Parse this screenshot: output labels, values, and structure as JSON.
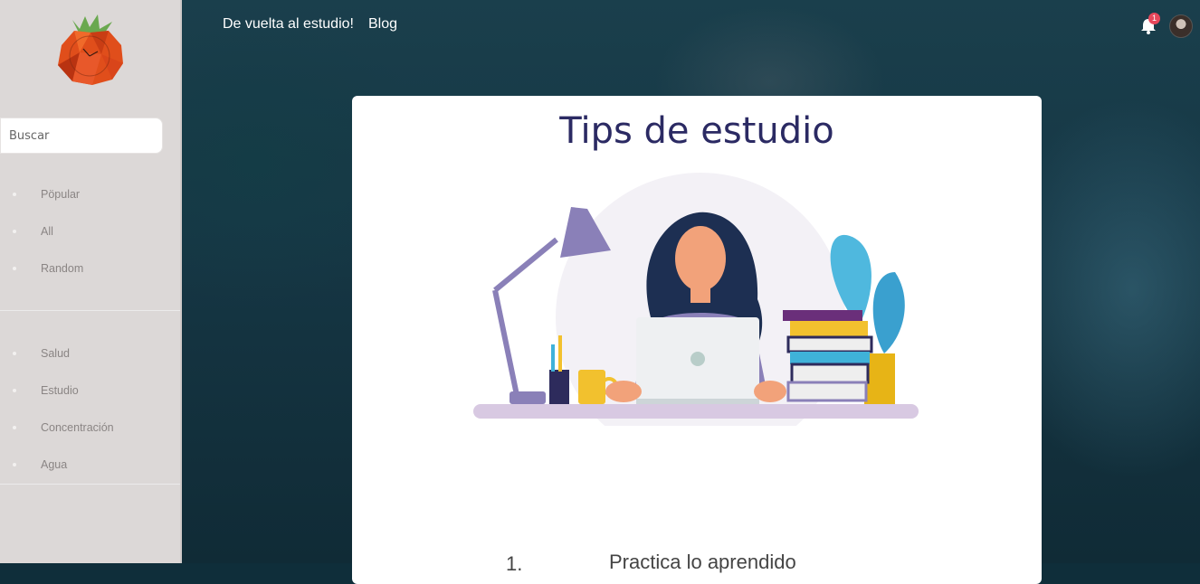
{
  "sidebar": {
    "search_placeholder": "Buscar",
    "primary_items": [
      {
        "label": "Pöpular"
      },
      {
        "label": "All"
      },
      {
        "label": "Random"
      }
    ],
    "category_items": [
      {
        "label": "Salud"
      },
      {
        "label": "Estudio"
      },
      {
        "label": "Concentración"
      },
      {
        "label": "Agua"
      }
    ]
  },
  "topnav": {
    "link1": "De vuelta al estudio!",
    "link2": "Blog"
  },
  "notifications": {
    "count": "1"
  },
  "card": {
    "title": "Tips de estudio",
    "tip_number": "1.",
    "tip_text": "Practica lo aprendido"
  },
  "icons": {
    "logo": "tomato-clock-icon",
    "bell": "bell-icon",
    "avatar": "user-avatar"
  },
  "colors": {
    "title": "#2b2a63",
    "badge": "#e8475b",
    "sidebar_bg": "#dcd8d7"
  }
}
